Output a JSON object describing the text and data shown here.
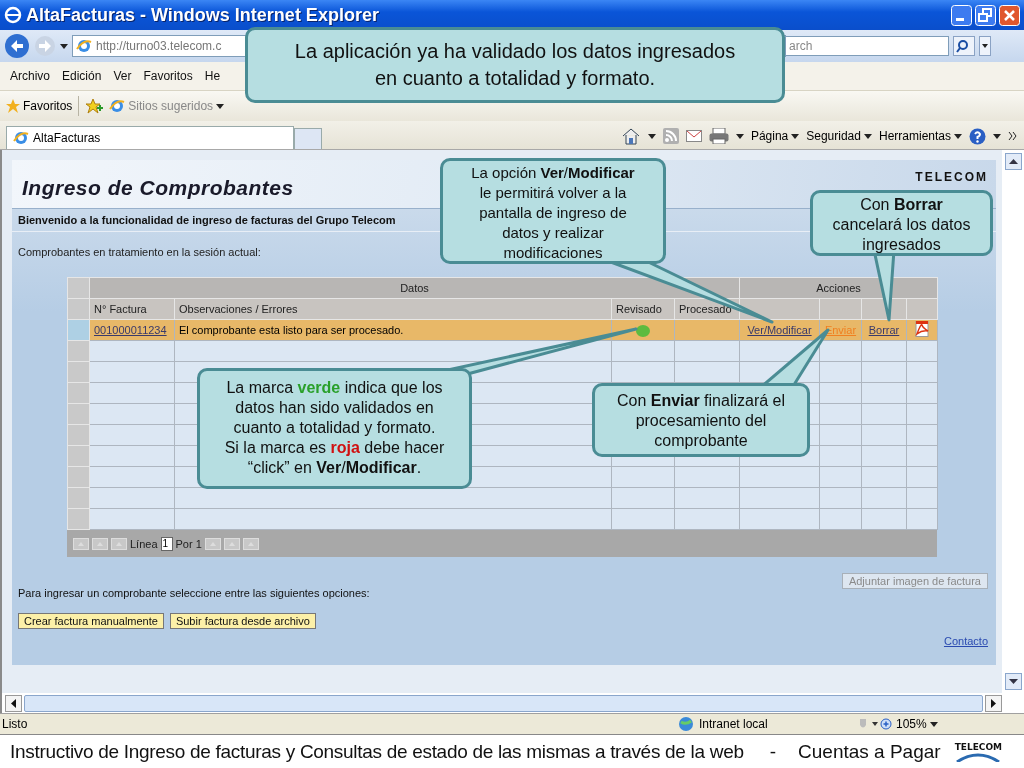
{
  "window": {
    "title": "AltaFacturas - Windows Internet Explorer"
  },
  "address_bar": {
    "url": "http://turno03.telecom.c",
    "search_placeholder": "arch"
  },
  "menu": [
    "Archivo",
    "Edición",
    "Ver",
    "Favoritos",
    "He"
  ],
  "favorites_bar": {
    "label": "Favoritos",
    "items": [
      {
        "label": "Sitios sugeridos",
        "kind": "dropdown"
      }
    ]
  },
  "tabs": [
    {
      "label": "AltaFacturas",
      "selected": true
    }
  ],
  "command_bar": [
    "Página",
    "Seguridad",
    "Herramientas"
  ],
  "page": {
    "brand": "TELECOM",
    "title": "Ingreso de Comprobantes",
    "welcome": "Bienvenido a la funcionalidad de ingreso de facturas del Grupo Telecom",
    "section_label": "Comprobantes en tratamiento en la sesión actual:",
    "table": {
      "groups": [
        "Datos",
        "Acciones"
      ],
      "columns": [
        "N° Factura",
        "Observaciones / Errores",
        "Revisado",
        "Procesado"
      ],
      "rows": [
        {
          "selected": true,
          "invoice": "001000011234",
          "observation": "El comprobante esta listo para ser procesado.",
          "color": "#5dbb3f",
          "actions": [
            {
              "label": "Ver/Modificar",
              "kind": "link"
            },
            {
              "label": "Enviar",
              "kind": "highlighted"
            },
            {
              "label": "Borrar",
              "kind": "link"
            },
            {
              "kind": "pdf"
            }
          ]
        }
      ],
      "pager": {
        "label": "Línea",
        "value": "1",
        "total": "Por 1"
      }
    },
    "attach_button": {
      "label": "Adjuntar imagen de factura",
      "disabled": true
    },
    "instructions": "Para ingresar un comprobante seleccione entre las siguientes opciones:",
    "buttons": [
      "Crear factura manualmente",
      "Subir factura desde archivo"
    ],
    "contact": "Contacto"
  },
  "status_bar": {
    "text": "Listo",
    "zone": "Intranet local",
    "zoom": "105%"
  },
  "footer": {
    "text": "Instructivo de Ingreso de facturas y Consultas de estado de las mismas a través de la web",
    "separator": "-",
    "section": "Cuentas a Pagar",
    "logo": "TELECOM"
  },
  "callouts": [
    {
      "lines": [
        [
          {
            "text": "La aplicación ya ha validado los datos ingresados"
          }
        ],
        [
          {
            "text": "en cuanto a totalidad y formato."
          }
        ]
      ]
    },
    {
      "lines": [
        [
          {
            "text": "La opción **Ver**/**Modificar**"
          }
        ],
        [
          {
            "text": "le permitirá volver a la"
          }
        ],
        [
          {
            "text": "pantalla de ingreso de"
          }
        ],
        [
          {
            "text": "datos y realizar"
          }
        ],
        [
          {
            "text": "modificaciones"
          }
        ]
      ]
    },
    {
      "lines": [
        [
          {
            "text": "Con **Borrar**"
          }
        ],
        [
          {
            "text": "cancelará los datos"
          }
        ],
        [
          {
            "text": "ingresados"
          }
        ]
      ]
    },
    {
      "lines": [
        [
          {
            "text": "La marca "
          },
          {
            "text": "verde",
            "kind": "positive"
          },
          {
            "text": " indica que los"
          }
        ],
        [
          {
            "text": "datos han sido validados en"
          }
        ],
        [
          {
            "text": "cuanto a totalidad y formato."
          }
        ],
        [
          {
            "text": "Si la marca es "
          },
          {
            "text": "roja",
            "kind": "negative"
          },
          {
            "text": " debe hacer"
          }
        ],
        [
          {
            "text": "“click” en **Ver**/**Modificar**."
          }
        ]
      ]
    },
    {
      "lines": [
        [
          {
            "text": "Con **Enviar** finalizará el"
          }
        ],
        [
          {
            "text": "procesamiento del"
          }
        ],
        [
          {
            "text": "comprobante"
          }
        ]
      ]
    }
  ]
}
